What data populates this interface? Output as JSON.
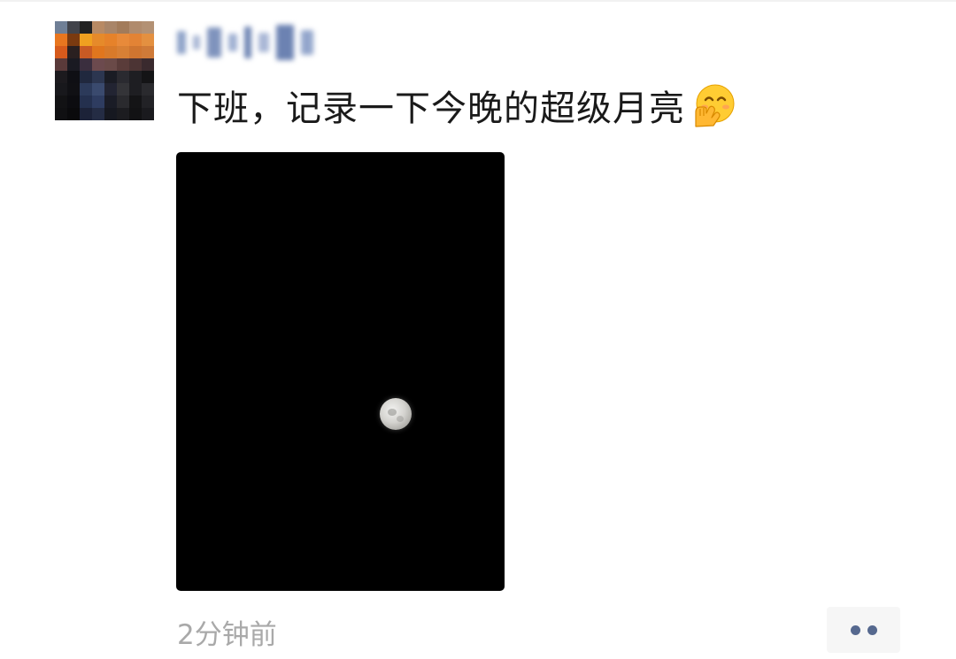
{
  "post": {
    "author": {
      "name": "",
      "avatar_icon": "pixelated-avatar"
    },
    "text": "下班，记录一下今晚的超级月亮",
    "emoji": "shushing-face-with-hand-emoji",
    "image": {
      "description_icon": "night-sky-moon-photo"
    },
    "timestamp": "2分钟前",
    "more_icon": "more-options-icon"
  },
  "colors": {
    "link_blue": "#56698f",
    "timestamp_gray": "#a9a9a9",
    "text_dark": "#1a1a1a",
    "photo_bg": "#000000"
  }
}
